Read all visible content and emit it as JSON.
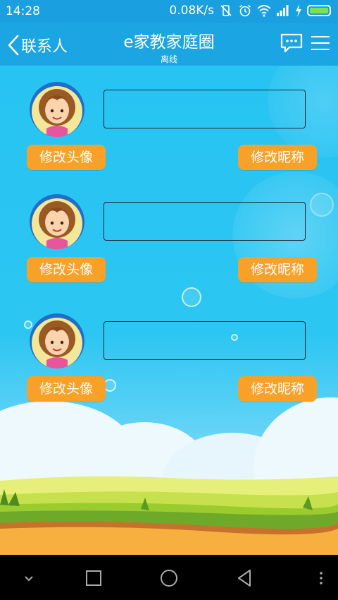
{
  "status": {
    "time": "14:28",
    "speed": "0.08K/s"
  },
  "header": {
    "back_label": "联系人",
    "title": "e家教家庭圈",
    "subtitle": "离线"
  },
  "members": [
    {
      "avatar_button": "修改头像",
      "nickname_button": "修改昵称",
      "nickname_value": ""
    },
    {
      "avatar_button": "修改头像",
      "nickname_button": "修改昵称",
      "nickname_value": ""
    },
    {
      "avatar_button": "修改头像",
      "nickname_button": "修改昵称",
      "nickname_value": ""
    }
  ],
  "icons": {
    "back": "chevron-left-icon",
    "chat": "chat-bubble-icon",
    "menu": "hamburger-menu-icon",
    "nav_down": "chevron-down-icon",
    "nav_recent": "square-icon",
    "nav_home": "circle-icon",
    "nav_back": "triangle-back-icon",
    "nav_more": "more-vertical-icon"
  },
  "colors": {
    "header": "#1ca5e3",
    "statusbar": "#1a9fe0",
    "button": "#f7a128",
    "sky": "#27c3f2"
  }
}
